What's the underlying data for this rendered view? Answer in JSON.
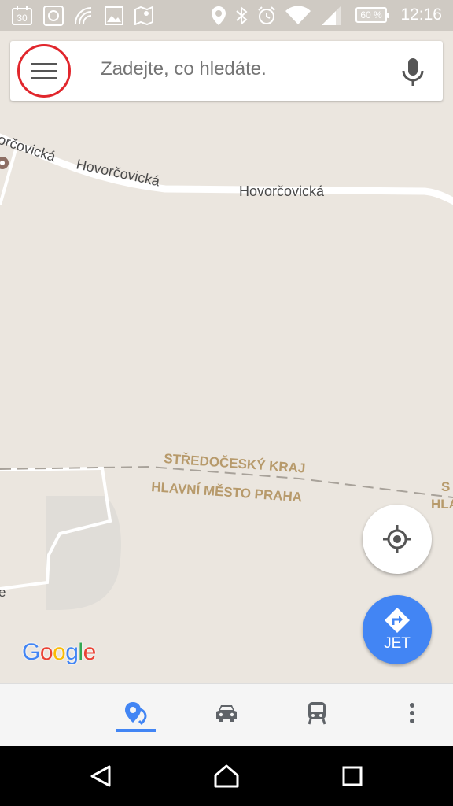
{
  "status_bar": {
    "calendar_date": "30",
    "battery_percent": "60 %",
    "time": "12:16",
    "icons": [
      "calendar-icon",
      "image-icon",
      "nfc-icon",
      "gallery-icon",
      "maps-icon",
      "location-icon",
      "bluetooth-icon",
      "alarm-icon",
      "wifi-icon",
      "signal-icon",
      "battery-icon"
    ]
  },
  "search": {
    "placeholder": "Zadejte, co hledáte."
  },
  "map": {
    "street_labels": [
      "orčovická",
      "Hovorčovická",
      "Hovorčovická"
    ],
    "region_labels": [
      "STŘEDOČESKÝ KRAJ",
      "HLAVNÍ MĚSTO PRAHA"
    ],
    "region_label_fragments": [
      "S",
      "HLA"
    ],
    "edge_fragment": "e",
    "logo": [
      "G",
      "o",
      "o",
      "g",
      "l",
      "e"
    ]
  },
  "buttons": {
    "go_label": "JET"
  },
  "colors": {
    "accent_blue": "#4285f4",
    "highlight_red": "#e1262c",
    "map_background": "#ebe6df",
    "label_tan": "#b79a6b"
  }
}
